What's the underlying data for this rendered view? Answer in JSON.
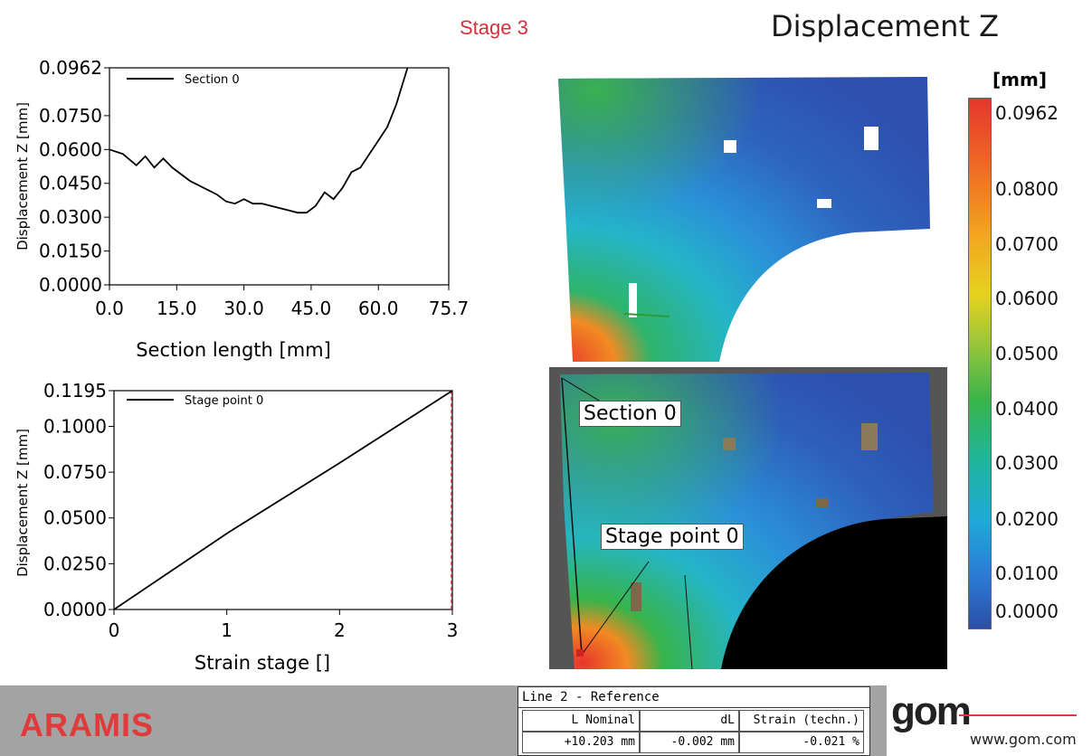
{
  "header": {
    "stage_label": "Stage 3",
    "title": "Displacement Z"
  },
  "charts": {
    "section": {
      "ylabel": "Displacement Z [mm]",
      "xlabel": "Section length [mm]",
      "legend": "Section 0",
      "yticks": [
        "0.0962",
        "0.0750",
        "0.0600",
        "0.0450",
        "0.0300",
        "0.0150",
        "0.0000"
      ],
      "xticks": [
        "0.0",
        "15.0",
        "30.0",
        "45.0",
        "60.0",
        "75.7"
      ]
    },
    "stage": {
      "ylabel": "Displacement Z [mm]",
      "xlabel": "Strain stage []",
      "legend": "Stage point 0",
      "yticks": [
        "0.1195",
        "0.1000",
        "0.0750",
        "0.0500",
        "0.0250",
        "0.0000"
      ],
      "xticks": [
        "0",
        "1",
        "2",
        "3"
      ]
    }
  },
  "chart_data": [
    {
      "type": "line",
      "xlabel": "Section length [mm]",
      "ylabel": "Displacement Z [mm]",
      "xlim": [
        0,
        75.7
      ],
      "ylim": [
        0,
        0.0962
      ],
      "series": [
        {
          "name": "Section 0",
          "x": [
            0,
            3,
            6,
            8,
            10,
            12,
            14,
            16,
            18,
            20,
            22,
            24,
            26,
            28,
            30,
            32,
            34,
            36,
            38,
            40,
            42,
            44,
            46,
            48,
            50,
            52,
            54,
            56,
            58,
            60,
            62,
            64,
            66.5
          ],
          "y": [
            0.06,
            0.058,
            0.053,
            0.057,
            0.052,
            0.056,
            0.052,
            0.049,
            0.046,
            0.044,
            0.042,
            0.04,
            0.037,
            0.036,
            0.038,
            0.036,
            0.036,
            0.035,
            0.034,
            0.033,
            0.032,
            0.032,
            0.035,
            0.041,
            0.038,
            0.043,
            0.05,
            0.052,
            0.058,
            0.064,
            0.07,
            0.08,
            0.0962
          ]
        }
      ]
    },
    {
      "type": "line",
      "xlabel": "Strain stage []",
      "ylabel": "Displacement Z [mm]",
      "xlim": [
        0,
        3
      ],
      "ylim": [
        0,
        0.1195
      ],
      "series": [
        {
          "name": "Stage point 0",
          "x": [
            0,
            1,
            2,
            3
          ],
          "y": [
            0,
            0.0415,
            0.08,
            0.1195
          ]
        }
      ]
    }
  ],
  "colorbar": {
    "unit": "[mm]",
    "labels": [
      "0.0962",
      "0.0800",
      "0.0700",
      "0.0600",
      "0.0500",
      "0.0400",
      "0.0300",
      "0.0200",
      "0.0100",
      "0.0000"
    ]
  },
  "callouts": {
    "section": "Section 0",
    "stage_point": "Stage point 0"
  },
  "footer": {
    "brand": "ARAMIS",
    "logo": "gom",
    "url": "www.gom.com",
    "table": {
      "title": "Line 2 - Reference",
      "headers": [
        "L Nominal",
        "dL",
        "Strain (techn.)"
      ],
      "values": [
        "+10.203 mm",
        "-0.002 mm",
        "-0.021 %"
      ]
    }
  },
  "colors": {
    "accent": "#e03a3a",
    "footer_bg": "#a3a3a3"
  }
}
